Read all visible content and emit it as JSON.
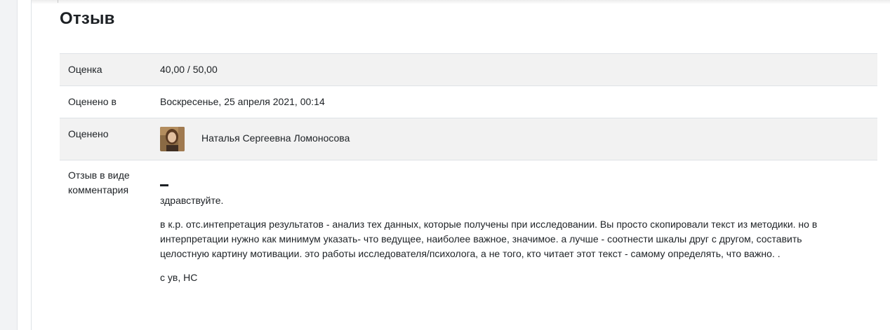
{
  "feedback": {
    "title": "Отзыв",
    "grade": {
      "label": "Оценка",
      "value": "40,00 / 50,00"
    },
    "graded_on": {
      "label": "Оценено в",
      "value": "Воскресенье, 25 апреля 2021, 00:14"
    },
    "graded_by": {
      "label": "Оценено",
      "name": "Наталья Сергеевна Ломоносова",
      "avatar": "user-avatar-photo"
    },
    "comments": {
      "label_line1": "Отзыв в виде",
      "label_line2": "комментария",
      "greeting": "здравствуйте.",
      "body": "в к.р. отс.интепретация результатов - анализ тех данных, которые получены при исследовании. Вы просто скопировали текст из методики. но в интерпретации нужно как минимум указать- что ведущее, наиболее важное, значимое. а лучше - соотнести шкалы друг с другом, составить целостную картину мотивации. это работы исследователя/психолога, а не того, кто читает этот текст - самому определять, что важно. .",
      "signature": "с ув, НС"
    }
  },
  "colors": {
    "row_shade": "#f2f2f2",
    "border": "#dee2e6",
    "text": "#1d2125"
  }
}
